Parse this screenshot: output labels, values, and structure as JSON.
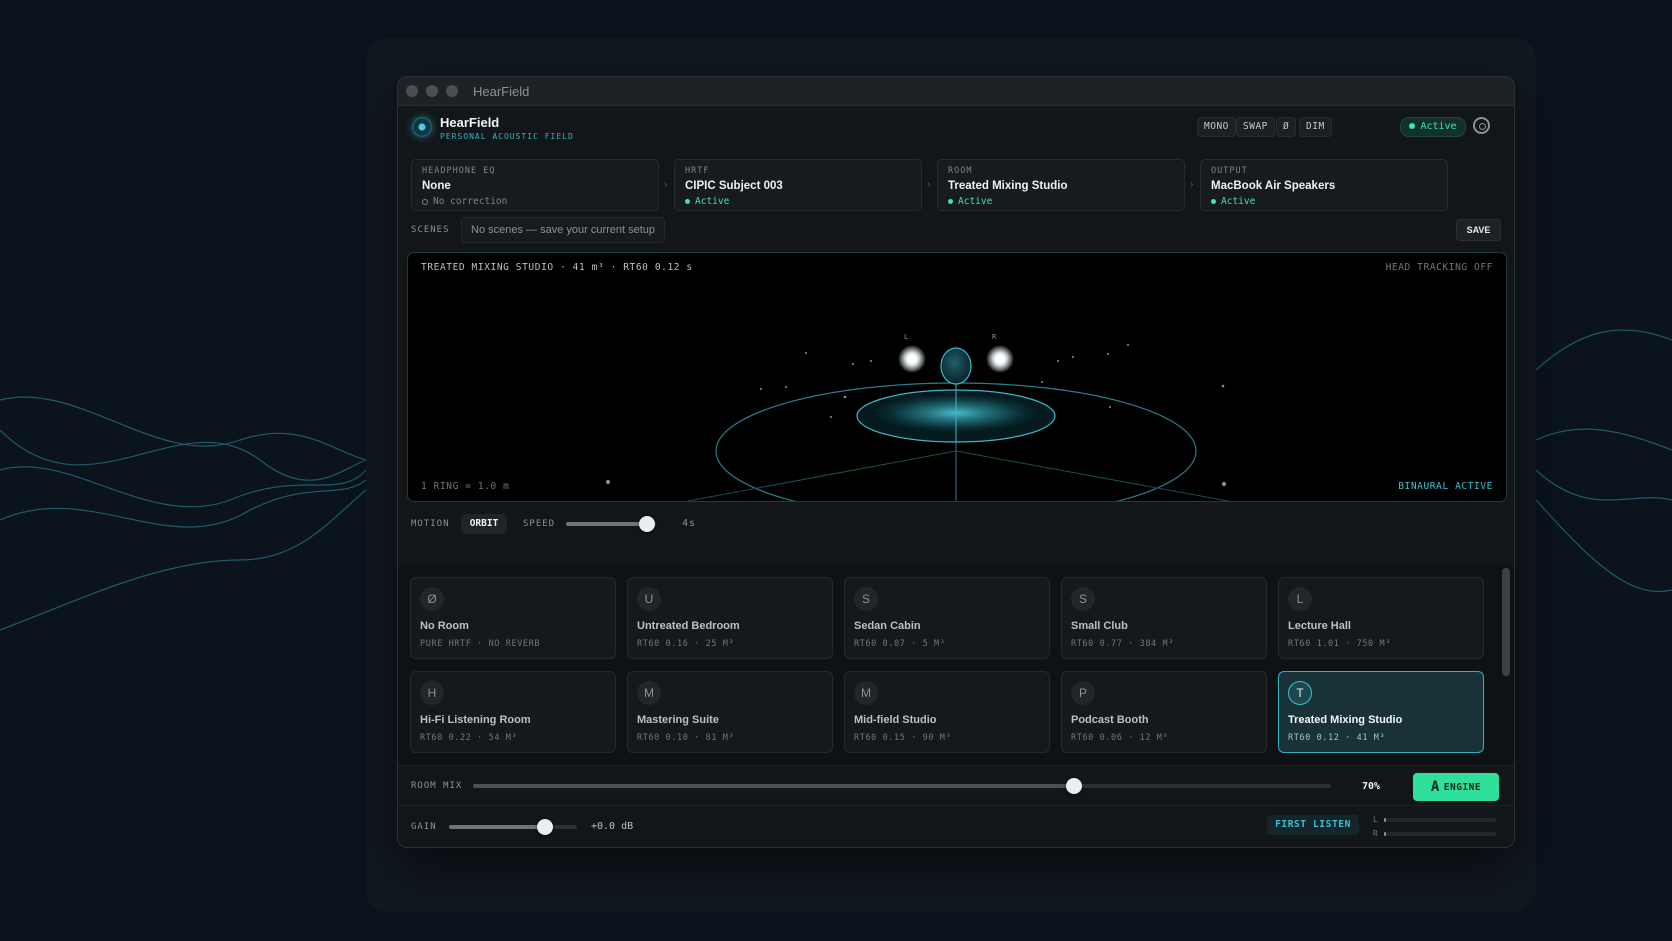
{
  "window": {
    "title": "HearField"
  },
  "header": {
    "app_name": "HearField",
    "app_subtitle": "PERSONAL ACOUSTIC FIELD",
    "chips": [
      "MONO",
      "SWAP",
      "Ø",
      "DIM"
    ],
    "status": "Active",
    "icons": {
      "listener": "listener-icon",
      "settings": "settings-icon"
    }
  },
  "chain": [
    {
      "label": "HEADPHONE EQ",
      "value": "None",
      "status": "No correction",
      "active": false
    },
    {
      "label": "HRTF",
      "value": "CIPIC Subject 003",
      "status": "Active",
      "active": true
    },
    {
      "label": "ROOM",
      "value": "Treated Mixing Studio",
      "status": "Active",
      "active": true
    },
    {
      "label": "OUTPUT",
      "value": "MacBook Air Speakers",
      "status": "Active",
      "active": true
    }
  ],
  "scenes": {
    "label": "SCENES",
    "empty_text": "No scenes — save your current setup",
    "save_label": "SAVE"
  },
  "visualizer": {
    "room_info": "TREATED MIXING STUDIO · 41 m³ · RT60 0.12 s",
    "head_tracking": "HEAD TRACKING OFF",
    "scale": "1 RING = 1.0 m",
    "binaural": "BINAURAL ACTIVE",
    "speaker_left": "L",
    "speaker_right": "R"
  },
  "motion": {
    "label": "MOTION",
    "mode": "ORBIT",
    "speed_label": "SPEED",
    "speed_value": "4s",
    "speed_level": 0.9
  },
  "rooms": [
    {
      "icon": "Ø",
      "name": "No Room",
      "meta": "PURE HRTF · NO REVERB",
      "selected": false
    },
    {
      "icon": "U",
      "name": "Untreated Bedroom",
      "meta": "RT60 0.16 · 25 M³",
      "selected": false
    },
    {
      "icon": "S",
      "name": "Sedan Cabin",
      "meta": "RT60 0.07 · 5 M³",
      "selected": false
    },
    {
      "icon": "S",
      "name": "Small Club",
      "meta": "RT60 0.77 · 384 M³",
      "selected": false
    },
    {
      "icon": "L",
      "name": "Lecture Hall",
      "meta": "RT60 1.01 · 750 M³",
      "selected": false
    },
    {
      "icon": "H",
      "name": "Hi-Fi Listening Room",
      "meta": "RT60 0.22 · 54 M³",
      "selected": false
    },
    {
      "icon": "M",
      "name": "Mastering Suite",
      "meta": "RT60 0.10 · 81 M³",
      "selected": false
    },
    {
      "icon": "M",
      "name": "Mid-field Studio",
      "meta": "RT60 0.15 · 90 M³",
      "selected": false
    },
    {
      "icon": "P",
      "name": "Podcast Booth",
      "meta": "RT60 0.06 · 12 M³",
      "selected": false
    },
    {
      "icon": "T",
      "name": "Treated Mixing Studio",
      "meta": "RT60 0.12 · 41 M³",
      "selected": true
    }
  ],
  "room_mix": {
    "label": "ROOM MIX",
    "value": "70%",
    "level": 0.7
  },
  "engine": {
    "letter": "A",
    "label": "ENGINE"
  },
  "gain": {
    "label": "GAIN",
    "value": "+0.0 dB",
    "level": 0.75
  },
  "first_listen": "FIRST LISTEN",
  "meters": {
    "left_label": "L",
    "right_label": "R",
    "left_level": 0.02,
    "right_level": 0.02
  },
  "colors": {
    "accent": "#2fb3c3",
    "green": "#3ee6a3",
    "engine": "#2fe09a",
    "background": "#0b131d"
  }
}
